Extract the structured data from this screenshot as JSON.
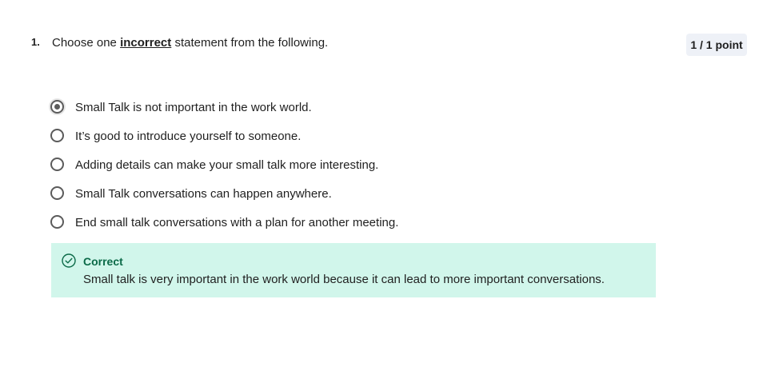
{
  "question": {
    "number": "1.",
    "text_before": "Choose one ",
    "text_emphasis": "incorrect",
    "text_after": " statement from the following.",
    "points": "1 / 1 point"
  },
  "options": [
    {
      "label": "Small Talk is not important in the work world.",
      "selected": true
    },
    {
      "label": "It’s good to introduce yourself to someone.",
      "selected": false
    },
    {
      "label": "Adding details can make your small talk more interesting.",
      "selected": false
    },
    {
      "label": "Small Talk conversations can happen anywhere.",
      "selected": false
    },
    {
      "label": "End small talk conversations with a plan for another meeting.",
      "selected": false
    }
  ],
  "feedback": {
    "icon": "check-circle-icon",
    "title": "Correct",
    "text": "Small talk is very important in the work world because it can lead to more important conversations.",
    "background_color": "#d1f6eb",
    "title_color": "#0b6a48"
  }
}
